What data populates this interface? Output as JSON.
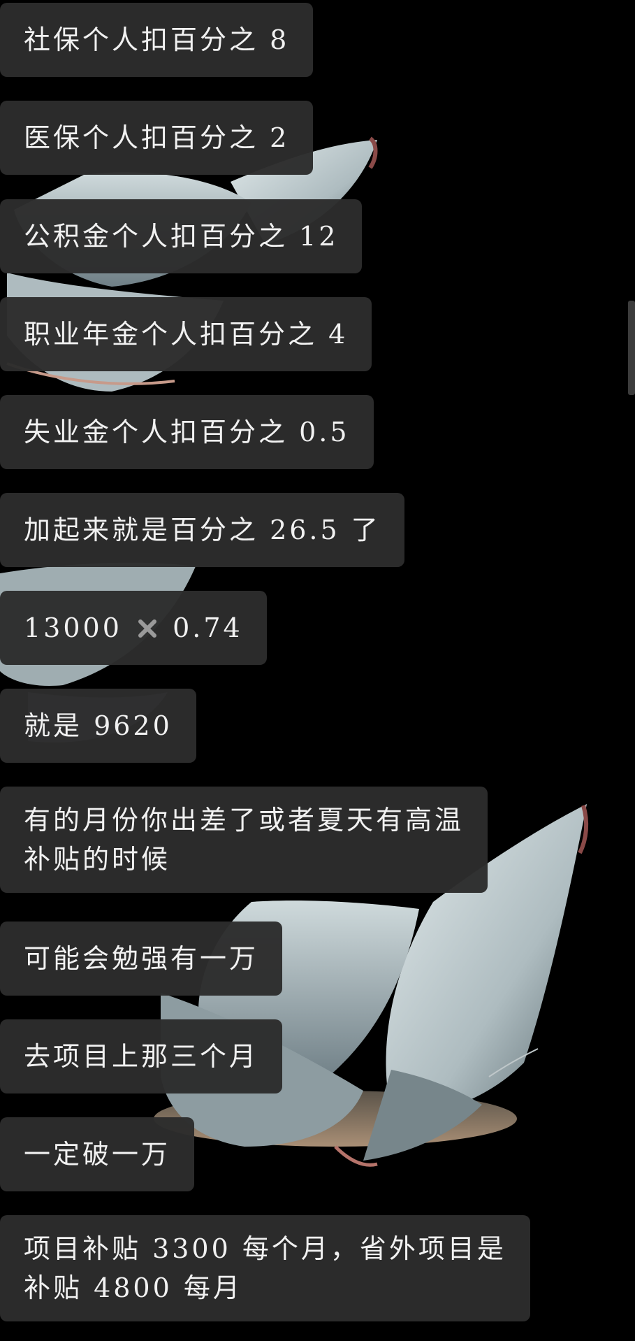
{
  "messages": [
    {
      "text": "社保个人扣百分之 8"
    },
    {
      "text": "医保个人扣百分之 2"
    },
    {
      "text": "公积金个人扣百分之 12"
    },
    {
      "text": "职业年金个人扣百分之 4"
    },
    {
      "text": "失业金个人扣百分之 0.5"
    },
    {
      "text": "加起来就是百分之 26.5 了"
    },
    {
      "parts": [
        "13000",
        "0.74"
      ]
    },
    {
      "text": "就是 9620"
    },
    {
      "lines": [
        "有的月份你出差了或者夏天有高温",
        "补贴的时候"
      ]
    },
    {
      "text": "可能会勉强有一万"
    },
    {
      "text": "去项目上那三个月"
    },
    {
      "text": "一定破一万"
    },
    {
      "lines": [
        "项目补贴 3300 每个月，省外项目是",
        "补贴 4800 每月"
      ]
    }
  ],
  "icons": {
    "multiply": "multiply-icon"
  },
  "colors": {
    "background": "#000000",
    "bubble": "#2c2c2c",
    "text": "#f1f1f1",
    "wing": "#c9d5d8"
  }
}
